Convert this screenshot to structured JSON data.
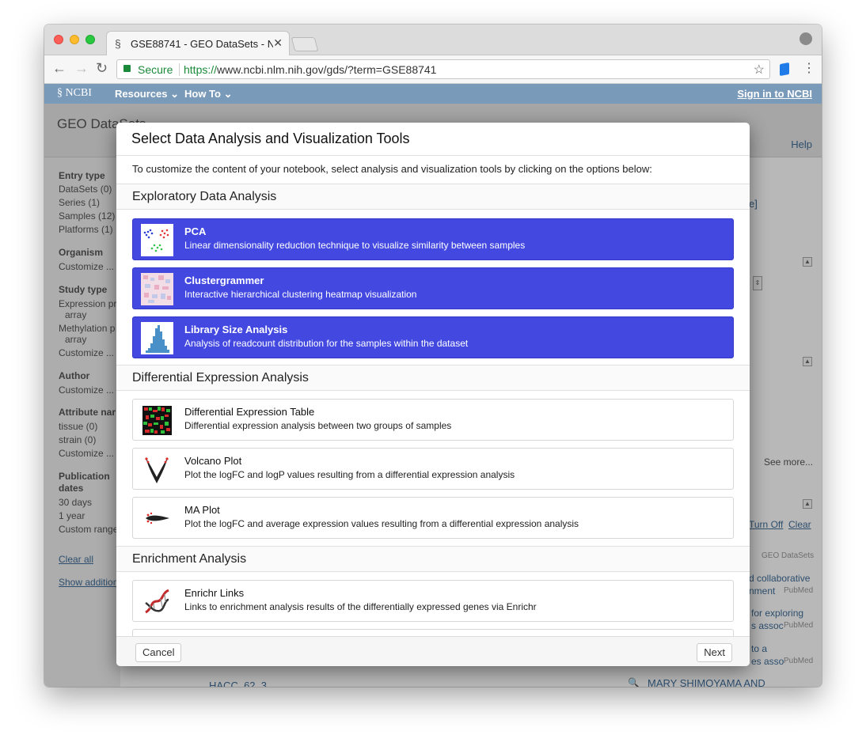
{
  "browser": {
    "tab_title": "GSE88741 - GEO DataSets - N",
    "tab_close": "✕",
    "secure_label": "Secure",
    "url_scheme": "https://",
    "url_host": "www.ncbi.nlm.nih.gov",
    "url_path": "/gds/?term=GSE88741"
  },
  "ncbi_bar": {
    "logo": "NCBI",
    "resources": "Resources ⌄",
    "howto": "How To ⌄",
    "signin": "Sign in to NCBI"
  },
  "geo": {
    "title": "GEO DataSets",
    "help": "Help"
  },
  "sidebar": {
    "entry_type": "Entry type",
    "datasets": "DataSets (0)",
    "series": "Series (1)",
    "samples": "Samples (12)",
    "platforms": "Platforms (1)",
    "organism": "Organism",
    "customize1": "Customize ...",
    "study_type": "Study type",
    "expression": "Expression pr",
    "array1": "array",
    "methylation": "Methylation p",
    "array2": "array",
    "customize2": "Customize ...",
    "author": "Author",
    "customize3": "Customize ...",
    "attribute": "Attribute nar",
    "tissue": "tissue (0)",
    "strain": "strain (0)",
    "customize4": "Customize ...",
    "publication": "Publication",
    "dates": "dates",
    "d30": "30 days",
    "y1": "1 year",
    "custom_range": "Custom range",
    "clear_all": "Clear all",
    "show_additional": "Show addition"
  },
  "right": {
    "link_e": "e]",
    "see_more": "See more...",
    "turn_off": "Turn Off",
    "clear": "Clear",
    "geo_datasets": "GEO DataSets",
    "r1a": "d collaborative",
    "r1b": "nment",
    "r2a": "for exploring",
    "r2b": "s assoc",
    "r3a": "to a",
    "r3b": "es asso",
    "pubmed": "PubMed",
    "mary": "MARY SHIMOYAMA AND",
    "hacc": "HACC_62_3"
  },
  "modal": {
    "title": "Select Data Analysis and Visualization Tools",
    "intro": "To customize the content of your notebook, select analysis and visualization tools by clicking on the options below:",
    "sections": [
      {
        "title": "Exploratory Data Analysis",
        "tools": [
          {
            "name": "PCA",
            "desc": "Linear dimensionality reduction technique to visualize similarity between samples",
            "selected": true
          },
          {
            "name": "Clustergrammer",
            "desc": "Interactive hierarchical clustering heatmap visualization",
            "selected": true
          },
          {
            "name": "Library Size Analysis",
            "desc": "Analysis of readcount distribution for the samples within the dataset",
            "selected": true
          }
        ]
      },
      {
        "title": "Differential Expression Analysis",
        "tools": [
          {
            "name": "Differential Expression Table",
            "desc": "Differential expression analysis between two groups of samples",
            "selected": false
          },
          {
            "name": "Volcano Plot",
            "desc": "Plot the logFC and logP values resulting from a differential expression analysis",
            "selected": false
          },
          {
            "name": "MA Plot",
            "desc": "Plot the logFC and average expression values resulting from a differential expression analysis",
            "selected": false
          }
        ]
      },
      {
        "title": "Enrichment Analysis",
        "tools": [
          {
            "name": "Enrichr Links",
            "desc": "Links to enrichment analysis results of the differentially expressed genes via Enrichr",
            "selected": false
          }
        ]
      }
    ],
    "cancel": "Cancel",
    "next": "Next"
  }
}
